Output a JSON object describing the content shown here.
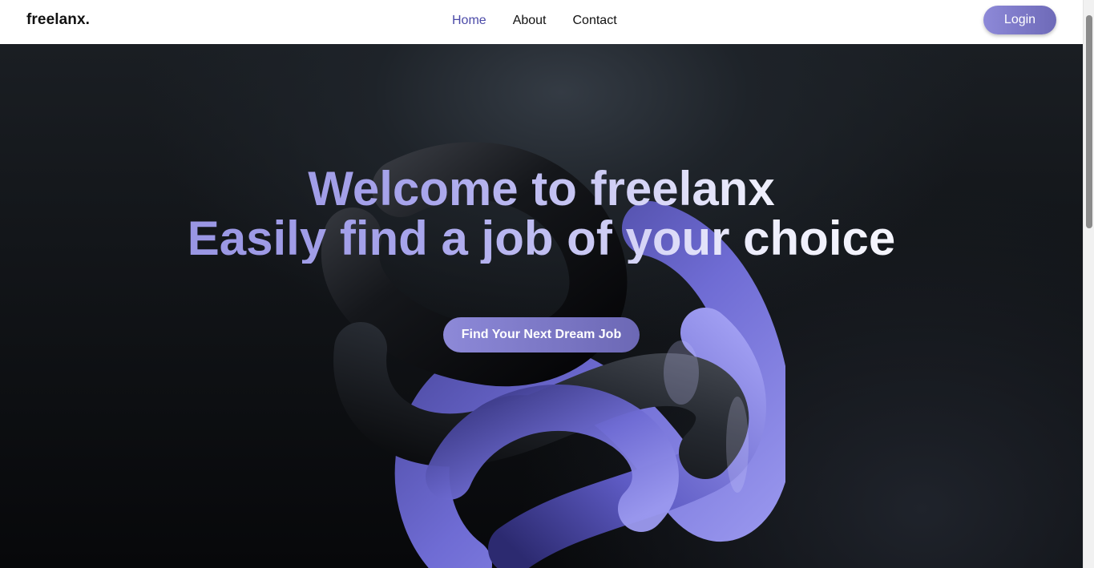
{
  "navbar": {
    "brand": "freelanx.",
    "links": [
      {
        "label": "Home",
        "active": true
      },
      {
        "label": "About",
        "active": false
      },
      {
        "label": "Contact",
        "active": false
      }
    ],
    "login_label": "Login"
  },
  "hero": {
    "title_line1": "Welcome to freelanx",
    "title_line2": "Easily find a job of your choice",
    "cta_label": "Find Your Next Dream Job"
  },
  "colors": {
    "accent": "#8d89d8",
    "accent_dark": "#6e6ab8",
    "nav_active": "#4b4aa8",
    "hero_background": "#0b0d10"
  }
}
